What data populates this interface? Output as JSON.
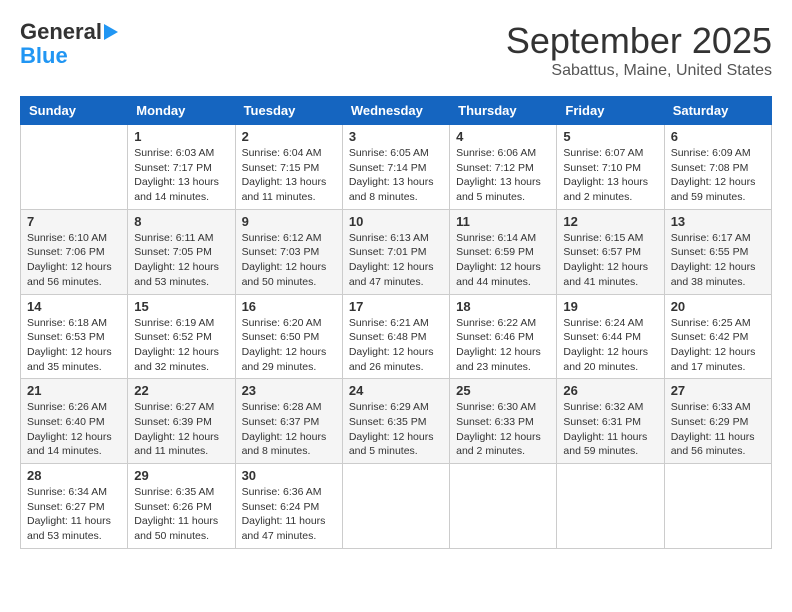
{
  "logo": {
    "general": "General",
    "blue": "Blue"
  },
  "title": "September 2025",
  "subtitle": "Sabattus, Maine, United States",
  "days": [
    "Sunday",
    "Monday",
    "Tuesday",
    "Wednesday",
    "Thursday",
    "Friday",
    "Saturday"
  ],
  "weeks": [
    [
      {
        "day": "",
        "info": ""
      },
      {
        "day": "1",
        "info": "Sunrise: 6:03 AM\nSunset: 7:17 PM\nDaylight: 13 hours\nand 14 minutes."
      },
      {
        "day": "2",
        "info": "Sunrise: 6:04 AM\nSunset: 7:15 PM\nDaylight: 13 hours\nand 11 minutes."
      },
      {
        "day": "3",
        "info": "Sunrise: 6:05 AM\nSunset: 7:14 PM\nDaylight: 13 hours\nand 8 minutes."
      },
      {
        "day": "4",
        "info": "Sunrise: 6:06 AM\nSunset: 7:12 PM\nDaylight: 13 hours\nand 5 minutes."
      },
      {
        "day": "5",
        "info": "Sunrise: 6:07 AM\nSunset: 7:10 PM\nDaylight: 13 hours\nand 2 minutes."
      },
      {
        "day": "6",
        "info": "Sunrise: 6:09 AM\nSunset: 7:08 PM\nDaylight: 12 hours\nand 59 minutes."
      }
    ],
    [
      {
        "day": "7",
        "info": "Sunrise: 6:10 AM\nSunset: 7:06 PM\nDaylight: 12 hours\nand 56 minutes."
      },
      {
        "day": "8",
        "info": "Sunrise: 6:11 AM\nSunset: 7:05 PM\nDaylight: 12 hours\nand 53 minutes."
      },
      {
        "day": "9",
        "info": "Sunrise: 6:12 AM\nSunset: 7:03 PM\nDaylight: 12 hours\nand 50 minutes."
      },
      {
        "day": "10",
        "info": "Sunrise: 6:13 AM\nSunset: 7:01 PM\nDaylight: 12 hours\nand 47 minutes."
      },
      {
        "day": "11",
        "info": "Sunrise: 6:14 AM\nSunset: 6:59 PM\nDaylight: 12 hours\nand 44 minutes."
      },
      {
        "day": "12",
        "info": "Sunrise: 6:15 AM\nSunset: 6:57 PM\nDaylight: 12 hours\nand 41 minutes."
      },
      {
        "day": "13",
        "info": "Sunrise: 6:17 AM\nSunset: 6:55 PM\nDaylight: 12 hours\nand 38 minutes."
      }
    ],
    [
      {
        "day": "14",
        "info": "Sunrise: 6:18 AM\nSunset: 6:53 PM\nDaylight: 12 hours\nand 35 minutes."
      },
      {
        "day": "15",
        "info": "Sunrise: 6:19 AM\nSunset: 6:52 PM\nDaylight: 12 hours\nand 32 minutes."
      },
      {
        "day": "16",
        "info": "Sunrise: 6:20 AM\nSunset: 6:50 PM\nDaylight: 12 hours\nand 29 minutes."
      },
      {
        "day": "17",
        "info": "Sunrise: 6:21 AM\nSunset: 6:48 PM\nDaylight: 12 hours\nand 26 minutes."
      },
      {
        "day": "18",
        "info": "Sunrise: 6:22 AM\nSunset: 6:46 PM\nDaylight: 12 hours\nand 23 minutes."
      },
      {
        "day": "19",
        "info": "Sunrise: 6:24 AM\nSunset: 6:44 PM\nDaylight: 12 hours\nand 20 minutes."
      },
      {
        "day": "20",
        "info": "Sunrise: 6:25 AM\nSunset: 6:42 PM\nDaylight: 12 hours\nand 17 minutes."
      }
    ],
    [
      {
        "day": "21",
        "info": "Sunrise: 6:26 AM\nSunset: 6:40 PM\nDaylight: 12 hours\nand 14 minutes."
      },
      {
        "day": "22",
        "info": "Sunrise: 6:27 AM\nSunset: 6:39 PM\nDaylight: 12 hours\nand 11 minutes."
      },
      {
        "day": "23",
        "info": "Sunrise: 6:28 AM\nSunset: 6:37 PM\nDaylight: 12 hours\nand 8 minutes."
      },
      {
        "day": "24",
        "info": "Sunrise: 6:29 AM\nSunset: 6:35 PM\nDaylight: 12 hours\nand 5 minutes."
      },
      {
        "day": "25",
        "info": "Sunrise: 6:30 AM\nSunset: 6:33 PM\nDaylight: 12 hours\nand 2 minutes."
      },
      {
        "day": "26",
        "info": "Sunrise: 6:32 AM\nSunset: 6:31 PM\nDaylight: 11 hours\nand 59 minutes."
      },
      {
        "day": "27",
        "info": "Sunrise: 6:33 AM\nSunset: 6:29 PM\nDaylight: 11 hours\nand 56 minutes."
      }
    ],
    [
      {
        "day": "28",
        "info": "Sunrise: 6:34 AM\nSunset: 6:27 PM\nDaylight: 11 hours\nand 53 minutes."
      },
      {
        "day": "29",
        "info": "Sunrise: 6:35 AM\nSunset: 6:26 PM\nDaylight: 11 hours\nand 50 minutes."
      },
      {
        "day": "30",
        "info": "Sunrise: 6:36 AM\nSunset: 6:24 PM\nDaylight: 11 hours\nand 47 minutes."
      },
      {
        "day": "",
        "info": ""
      },
      {
        "day": "",
        "info": ""
      },
      {
        "day": "",
        "info": ""
      },
      {
        "day": "",
        "info": ""
      }
    ]
  ]
}
